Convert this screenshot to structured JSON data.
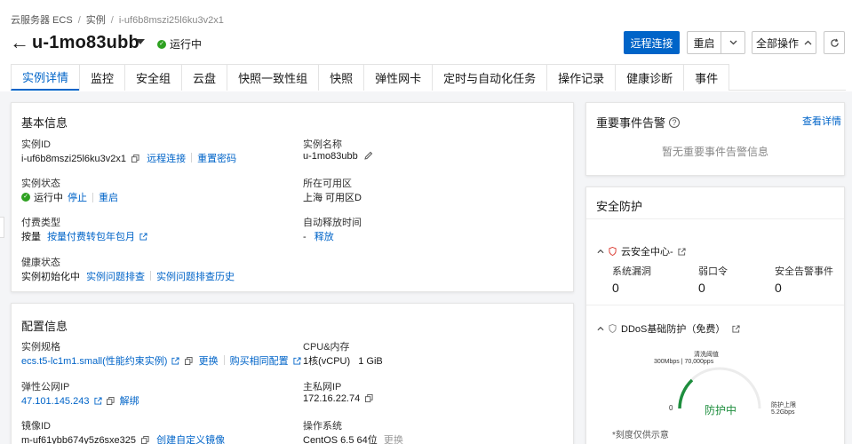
{
  "breadcrumb": [
    "云服务器 ECS",
    "实例",
    "i-uf6b8mszi25l6ku3v2x1"
  ],
  "instance": {
    "name": "u-1mo83ubb",
    "status": "运行中"
  },
  "header_buttons": {
    "remote": "远程连接",
    "restart": "重启",
    "all_ops": "全部操作"
  },
  "tabs": [
    "实例详情",
    "监控",
    "安全组",
    "云盘",
    "快照一致性组",
    "快照",
    "弹性网卡",
    "定时与自动化任务",
    "操作记录",
    "健康诊断",
    "事件"
  ],
  "basic": {
    "title": "基本信息",
    "id_label": "实例ID",
    "id_value": "i-uf6b8mszi25l6ku3v2x1",
    "id_link1": "远程连接",
    "id_link2": "重置密码",
    "name_label": "实例名称",
    "name_value": "u-1mo83ubb",
    "state_label": "实例状态",
    "state_value": "运行中",
    "state_link1": "停止",
    "state_link2": "重启",
    "zone_label": "所在可用区",
    "zone_value": "上海 可用区D",
    "pay_label": "付费类型",
    "pay_value": "按量",
    "pay_link": "按量付费转包年包月",
    "release_label": "自动释放时间",
    "release_value": "-",
    "release_link": "释放",
    "health_label": "健康状态",
    "health_value": "实例初始化中",
    "health_link1": "实例问题排查",
    "health_link2": "实例问题排查历史"
  },
  "config": {
    "title": "配置信息",
    "spec_label": "实例规格",
    "spec_value": "ecs.t5-lc1m1.small(性能约束实例)",
    "spec_link1": "更换",
    "spec_link2": "购买相同配置",
    "cpu_label": "CPU&内存",
    "cpu_value": "1核(vCPU)",
    "mem_value": "1 GiB",
    "eip_label": "弹性公网IP",
    "eip_value": "47.101.145.243",
    "eip_link": "解绑",
    "pip_label": "主私网IP",
    "pip_value": "172.16.22.74",
    "image_label": "镜像ID",
    "image_value": "m-uf61ybb674y5z6sxe325",
    "image_link": "创建自定义镜像",
    "os_label": "操作系统",
    "os_value": "CentOS 6.5 64位",
    "os_link": "更换"
  },
  "events": {
    "title": "重要事件告警",
    "link": "查看详情",
    "empty": "暂无重要事件告警信息"
  },
  "security": {
    "title": "安全防护",
    "cloud_center": "云安全中心-",
    "cols": [
      "系统漏洞",
      "弱口令",
      "安全告警事件"
    ],
    "vals": [
      "0",
      "0",
      "0"
    ],
    "ddos": "DDoS基础防护（免费）",
    "gauge_top1": "清洗阈值",
    "gauge_top2": "300Mbps | 70,000pps",
    "gauge_zero": "0",
    "gauge_status": "防护中",
    "gauge_limit1": "防护上限",
    "gauge_limit2": "5.2Gbps",
    "note": "*刻度仅供示意"
  }
}
